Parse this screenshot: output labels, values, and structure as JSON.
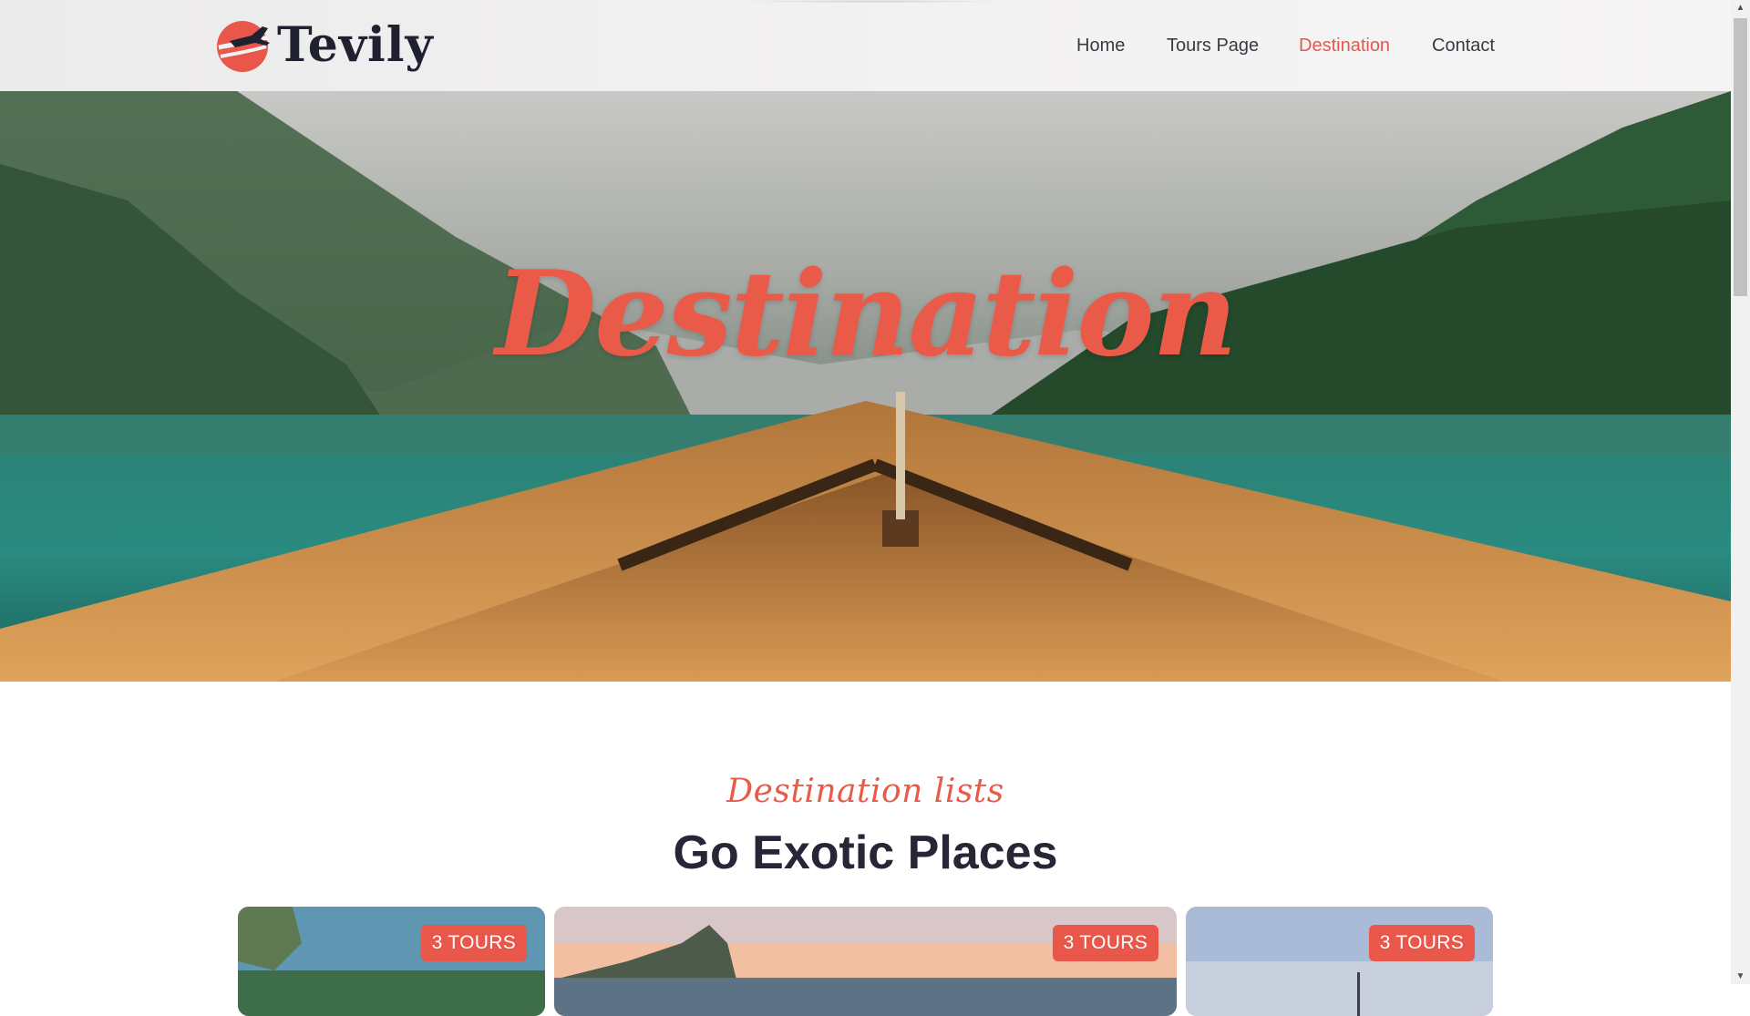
{
  "brand": {
    "name": "Tevily",
    "accent": "#e8574a",
    "dark": "#1f2030"
  },
  "nav": {
    "items": [
      {
        "label": "Home"
      },
      {
        "label": "Tours Page"
      },
      {
        "label": "Destination"
      },
      {
        "label": "Contact"
      }
    ],
    "active": "Destination"
  },
  "hero": {
    "title": "Destination"
  },
  "section": {
    "subtitle": "Destination lists",
    "title": "Go Exotic Places"
  },
  "cards": [
    {
      "badge": "3 TOURS"
    },
    {
      "badge": "3 TOURS"
    },
    {
      "badge": "3 TOURS"
    }
  ]
}
